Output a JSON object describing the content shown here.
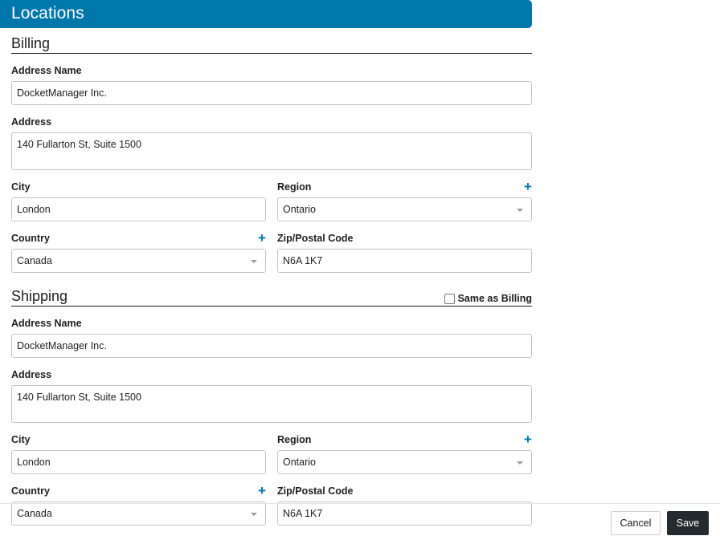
{
  "header": {
    "title": "Locations"
  },
  "billing": {
    "title": "Billing",
    "address_name": {
      "label": "Address Name",
      "value": "DocketManager Inc."
    },
    "address": {
      "label": "Address",
      "value": "140 Fullarton St, Suite 1500"
    },
    "city": {
      "label": "City",
      "value": "London"
    },
    "region": {
      "label": "Region",
      "value": "Ontario"
    },
    "country": {
      "label": "Country",
      "value": "Canada"
    },
    "zip": {
      "label": "Zip/Postal Code",
      "value": "N6A 1K7"
    }
  },
  "shipping": {
    "title": "Shipping",
    "same_as_billing": {
      "label": "Same as Billing",
      "checked": false
    },
    "address_name": {
      "label": "Address Name",
      "value": "DocketManager Inc."
    },
    "address": {
      "label": "Address",
      "value": "140 Fullarton St, Suite 1500"
    },
    "city": {
      "label": "City",
      "value": "London"
    },
    "region": {
      "label": "Region",
      "value": "Ontario"
    },
    "country": {
      "label": "Country",
      "value": "Canada"
    },
    "zip": {
      "label": "Zip/Postal Code",
      "value": "N6A 1K7"
    }
  },
  "footer": {
    "cancel_label": "Cancel",
    "save_label": "Save"
  },
  "icons": {
    "add": "plus-icon",
    "dropdown": "chevron-down-icon"
  },
  "colors": {
    "accent": "#0077ab",
    "save_button": "#252a2e",
    "border": "#c4c4c4"
  }
}
